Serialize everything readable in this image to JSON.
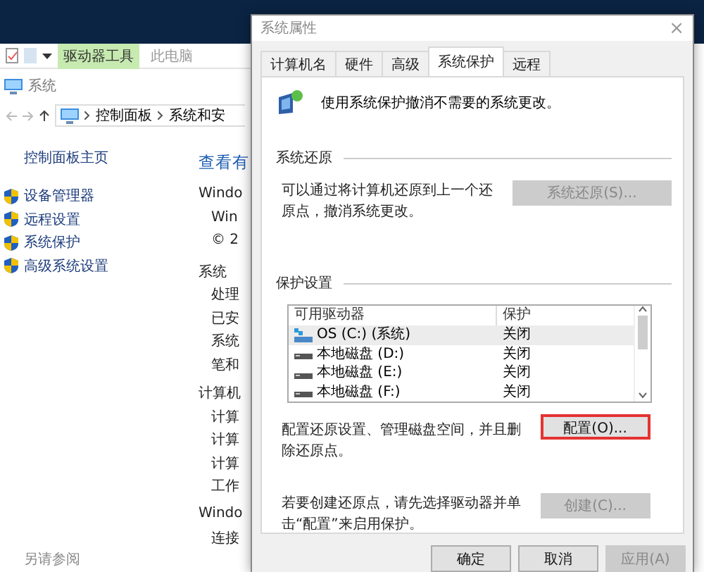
{
  "explorer": {
    "ribbon_tabs": [
      {
        "label": "驱动器工具",
        "kind": "context"
      },
      {
        "label": "此电脑",
        "kind": "plain"
      }
    ],
    "title": "系统",
    "address": [
      "控制面板",
      "系统和安"
    ],
    "nav_home": "控制面板主页",
    "nav_items": [
      "设备管理器",
      "远程设置",
      "系统保护",
      "高级系统设置"
    ],
    "see_also": "另请参阅",
    "content": [
      {
        "text": "查看有",
        "kind": "heading"
      },
      {
        "text": "Windo",
        "kind": "section"
      },
      {
        "text": "Win",
        "kind": "item"
      },
      {
        "text": "© 2",
        "kind": "item"
      },
      {
        "text": "系统",
        "kind": "section"
      },
      {
        "text": "处理",
        "kind": "item"
      },
      {
        "text": "已安",
        "kind": "item"
      },
      {
        "text": "系统",
        "kind": "item"
      },
      {
        "text": "笔和",
        "kind": "item"
      },
      {
        "text": "计算机",
        "kind": "section"
      },
      {
        "text": "计算",
        "kind": "item"
      },
      {
        "text": "计算",
        "kind": "item"
      },
      {
        "text": "计算",
        "kind": "item"
      },
      {
        "text": "工作",
        "kind": "item"
      },
      {
        "text": "Windo",
        "kind": "section"
      },
      {
        "text": "连接",
        "kind": "item"
      }
    ]
  },
  "dialog": {
    "title": "系统属性",
    "close": "×",
    "tabs": [
      {
        "label": "计算机名",
        "selected": false
      },
      {
        "label": "硬件",
        "selected": false
      },
      {
        "label": "高级",
        "selected": false
      },
      {
        "label": "系统保护",
        "selected": true
      },
      {
        "label": "远程",
        "selected": false
      }
    ],
    "description": "使用系统保护撤消不需要的系统更改。",
    "restore": {
      "heading": "系统还原",
      "text": "可以通过将计算机还原到上一个还原点，撤消系统更改。",
      "button": {
        "label": "系统还原(S)...",
        "disabled": true
      }
    },
    "protection": {
      "heading": "保护设置",
      "columns": [
        "可用驱动器",
        "保护"
      ],
      "drives": [
        {
          "name": "OS (C:) (系统)",
          "status": "关闭",
          "kind": "system",
          "selected": true
        },
        {
          "name": "本地磁盘 (D:)",
          "status": "关闭",
          "kind": "local",
          "selected": false
        },
        {
          "name": "本地磁盘 (E:)",
          "status": "关闭",
          "kind": "local",
          "selected": false
        },
        {
          "name": "本地磁盘 (F:)",
          "status": "关闭",
          "kind": "local",
          "selected": false
        }
      ],
      "configure": {
        "text": "配置还原设置、管理磁盘空间，并且删除还原点。",
        "button": {
          "label": "配置(O)...",
          "disabled": false,
          "highlighted": true
        }
      },
      "create": {
        "text": "若要创建还原点，请先选择驱动器并单击“配置”来启用保护。",
        "button": {
          "label": "创建(C)...",
          "disabled": true,
          "highlighted": false
        }
      }
    },
    "buttons": [
      {
        "label": "确定",
        "disabled": false
      },
      {
        "label": "取消",
        "disabled": false
      },
      {
        "label": "应用(A)",
        "disabled": true
      }
    ]
  }
}
